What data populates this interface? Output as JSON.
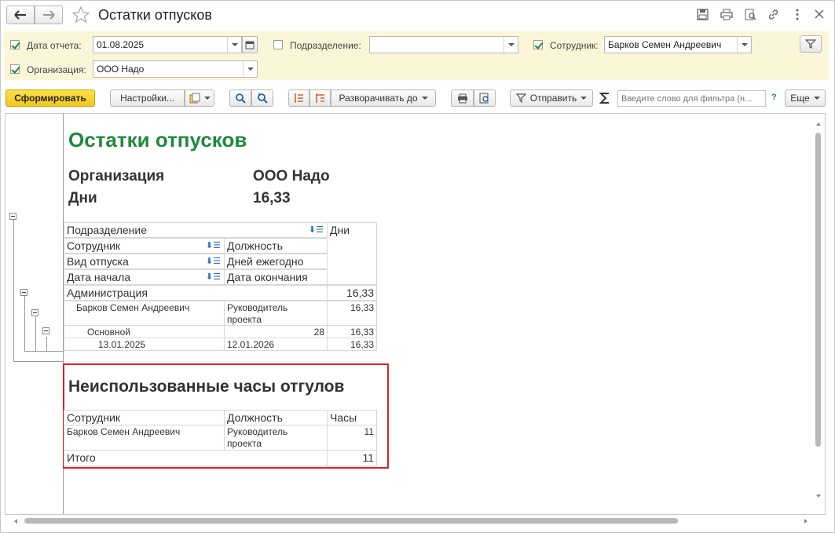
{
  "window": {
    "title": "Остатки отпусков"
  },
  "filters": {
    "date_label": "Дата отчета:",
    "date_value": "01.08.2025",
    "dept_label": "Подразделение:",
    "dept_value": "",
    "employee_label": "Сотрудник:",
    "employee_value": "Барков Семен Андреевич",
    "org_label": "Организация:",
    "org_value": "ООО Надо"
  },
  "toolbar": {
    "generate": "Сформировать",
    "settings": "Настройки...",
    "expand": "Разворачивать до",
    "send": "Отправить",
    "filter_placeholder": "Введите слово для фильтра (н...",
    "help": "?",
    "more": "Еще"
  },
  "report": {
    "title": "Остатки отпусков",
    "params": [
      {
        "label": "Организация",
        "value": "ООО Надо"
      },
      {
        "label": "Дни",
        "value": "16,33"
      }
    ],
    "headers": {
      "dept": "Подразделение",
      "days": "Дни",
      "employee": "Сотрудник",
      "position": "Должность",
      "vac_type": "Вид отпуска",
      "per_year": "Дней ежегодно",
      "start": "Дата начала",
      "end": "Дата окончания"
    },
    "rows": {
      "group": {
        "name": "Администрация",
        "days": "16,33"
      },
      "employee": {
        "name": "Барков Семен Андреевич",
        "position": "Руководитель проекта",
        "days": "16,33"
      },
      "type": {
        "name": "Основной",
        "per_year": "28",
        "days": "16,33"
      },
      "period": {
        "start": "13.01.2025",
        "end": "12.01.2026",
        "days": "16,33"
      }
    },
    "section2": {
      "title": "Неиспользованные часы отгулов",
      "headers": {
        "employee": "Сотрудник",
        "position": "Должность",
        "hours": "Часы"
      },
      "row": {
        "employee": "Барков Семен Андреевич",
        "position": "Руководитель проекта",
        "hours": "11"
      },
      "total": {
        "label": "Итого",
        "hours": "11"
      }
    }
  },
  "colors": {
    "accent_green": "#1e8a3c",
    "highlight_red": "#e02020",
    "generate_yellow": "#f5d327",
    "filter_bg": "#fbf6d8"
  }
}
